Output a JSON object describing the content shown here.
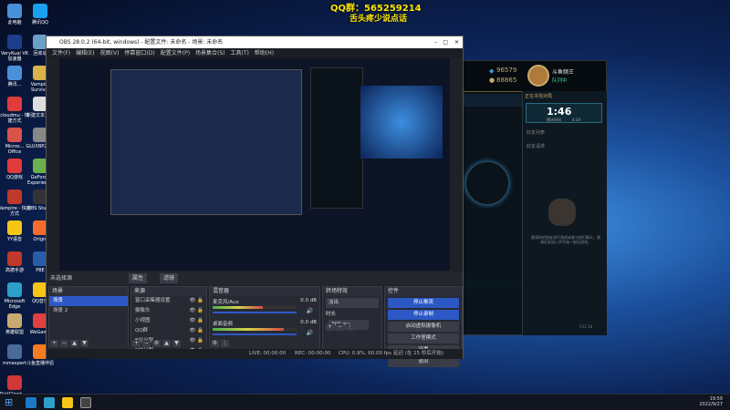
{
  "banner": {
    "qq": "QQ群：565259214",
    "slogan": "舌头疼少说点话"
  },
  "desktop_icons": [
    {
      "label": "此电脑",
      "color": "#4a90d9"
    },
    {
      "label": "腾讯QQ",
      "color": "#1aa0f0"
    },
    {
      "label": "VeryKuai VK 加速器",
      "color": "#1c3d8a"
    },
    {
      "label": "回收站",
      "color": "#6aa0c8"
    },
    {
      "label": "腾讯...",
      "color": "#4a90d9"
    },
    {
      "label": "Vampire Surviv...",
      "color": "#d9b34a"
    },
    {
      "label": "cloudmu - 快捷方式",
      "color": "#e03c3c"
    },
    {
      "label": "新建文本文档",
      "color": "#dddddd"
    },
    {
      "label": "Micros... Office",
      "color": "#d9534a"
    },
    {
      "label": "GLUXBP2B...",
      "color": "#888888"
    },
    {
      "label": "QQ游戏",
      "color": "#e03c3c"
    },
    {
      "label": "GeForce Experience",
      "color": "#6ab04c"
    },
    {
      "label": "Vampire - 快捷方式",
      "color": "#c0392b"
    },
    {
      "label": "OBS Studio",
      "color": "#333333"
    },
    {
      "label": "YY语音",
      "color": "#f5c518"
    },
    {
      "label": "Origin",
      "color": "#f56c2d"
    },
    {
      "label": "高德手游",
      "color": "#c0392b"
    },
    {
      "label": "PBE",
      "color": "#2a5ca8"
    },
    {
      "label": "Microsoft Edge",
      "color": "#2ba0c8"
    },
    {
      "label": "QQ音乐",
      "color": "#f5c518"
    },
    {
      "label": "英雄联盟",
      "color": "#c8aa6e"
    },
    {
      "label": "WeGame",
      "color": "#e04040"
    },
    {
      "label": "mmexpert",
      "color": "#4a6a9a"
    },
    {
      "label": "斗鱼直播伴侣",
      "color": "#f57c20"
    },
    {
      "label": "RiotClient... - 快捷方式",
      "color": "#d13639"
    }
  ],
  "lol": {
    "blue_essence": "96579",
    "rp": "88865",
    "player_name": "斗鱼频王",
    "status": "队列中",
    "queue_title": "正在寻找对局",
    "timer": "1:46",
    "timer_sub": "预计时间",
    "timer_est": "4:34",
    "friends_header": "好友列表",
    "friends_group": "好友请求",
    "empty_text": "邀请你的朋友进行游戏或者与他们聊天。邀请好友加入并开始一起玩游戏。",
    "version": "V12.18"
  },
  "obs": {
    "title": "OBS 28.0.2 (64-bit, windows) - 配置文件: 未命名 - 场景: 未命名",
    "menu": [
      "文件(F)",
      "编辑(E)",
      "视图(V)",
      "停靠窗口(D)",
      "配置文件(P)",
      "场景集合(S)",
      "工具(T)",
      "帮助(H)"
    ],
    "no_source": "未选择源",
    "props_btn": "属性",
    "filters_btn": "滤镜",
    "docks": {
      "scenes": {
        "title": "场景",
        "items": [
          "场景",
          "场景 2"
        ]
      },
      "sources": {
        "title": "来源",
        "items": [
          "窗口采集器设置",
          "摄像头",
          "小视图",
          "QQ群",
          "B站分割",
          "B站分割"
        ]
      },
      "mixer": {
        "title": "混音器",
        "tracks": [
          {
            "name": "麦克风/Aux",
            "db": "0.0 dB",
            "level": 0.6
          },
          {
            "name": "桌面音频",
            "db": "0.0 dB",
            "level": 0.85
          }
        ]
      },
      "transitions": {
        "title": "转场特效",
        "type": "淡出",
        "duration_label": "时长",
        "duration": "300 ms"
      },
      "controls": {
        "title": "控件",
        "buttons": [
          "停止推流",
          "停止录制",
          "启动虚拟摄像机",
          "工作室模式",
          "设置",
          "退出"
        ]
      }
    },
    "status": {
      "live": "LIVE: 00:00:00",
      "rec": "REC: 00:00:00",
      "cpu": "CPU: 0.9%, 60.00 fps",
      "delay": "延迟 (在 15 秒后开始)"
    }
  },
  "taskbar": {
    "time": "19:59",
    "date": "2022/9/27"
  }
}
